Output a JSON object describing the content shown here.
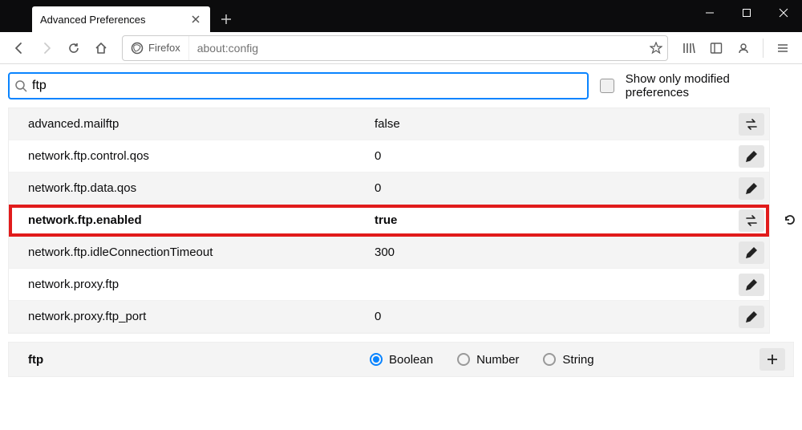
{
  "window": {
    "tab_title": "Advanced Preferences"
  },
  "navbar": {
    "identity_label": "Firefox",
    "url": "about:config"
  },
  "search": {
    "placeholder": "",
    "value": "ftp",
    "show_modified_label": "Show only modified preferences"
  },
  "prefs": [
    {
      "key": "advanced.mailftp",
      "value": "false",
      "action": "toggle",
      "highlight": false
    },
    {
      "key": "network.ftp.control.qos",
      "value": "0",
      "action": "edit",
      "highlight": false
    },
    {
      "key": "network.ftp.data.qos",
      "value": "0",
      "action": "edit",
      "highlight": false
    },
    {
      "key": "network.ftp.enabled",
      "value": "true",
      "action": "toggle",
      "highlight": true,
      "has_reset": true
    },
    {
      "key": "network.ftp.idleConnectionTimeout",
      "value": "300",
      "action": "edit",
      "highlight": false
    },
    {
      "key": "network.proxy.ftp",
      "value": "",
      "action": "edit",
      "highlight": false
    },
    {
      "key": "network.proxy.ftp_port",
      "value": "0",
      "action": "edit",
      "highlight": false
    }
  ],
  "addrow": {
    "key": "ftp",
    "types": [
      "Boolean",
      "Number",
      "String"
    ],
    "selected": "Boolean"
  }
}
